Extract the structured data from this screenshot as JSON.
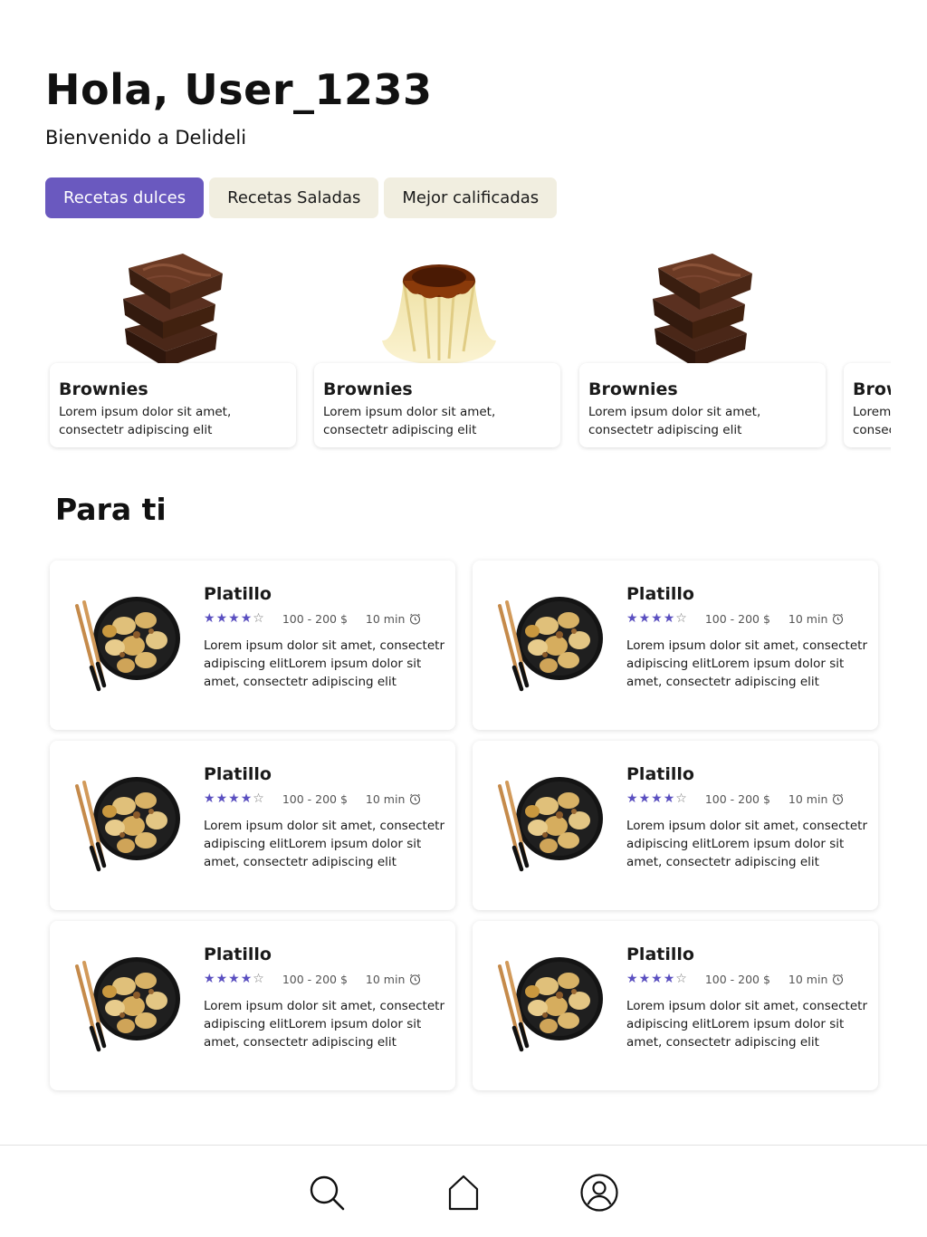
{
  "header": {
    "greeting": "Hola, User_1233",
    "subtitle": "Bienvenido a Delideli"
  },
  "tabs": [
    {
      "label": "Recetas dulces",
      "active": true
    },
    {
      "label": "Recetas Saladas",
      "active": false
    },
    {
      "label": "Mejor calificadas",
      "active": false
    }
  ],
  "sweets": [
    {
      "name": "Brownies",
      "description": "Lorem ipsum dolor sit amet, consectetr adipiscing elit",
      "image": "brownie"
    },
    {
      "name": "Brownies",
      "description": "Lorem ipsum dolor sit amet, consectetr adipiscing elit",
      "image": "flan"
    },
    {
      "name": "Brownies",
      "description": "Lorem ipsum dolor sit amet, consectetr adipiscing elit",
      "image": "brownie"
    },
    {
      "name": "Brownies",
      "description": "Lorem ipsum dolor sit amet, consectetr adipiscing elit",
      "image": "brownie"
    }
  ],
  "for_you": {
    "title": "Para ti",
    "dishes": [
      {
        "name": "Platillo",
        "rating": 4,
        "max_rating": 5,
        "price": "100 - 200 $",
        "time": "10 min",
        "description": "Lorem ipsum dolor sit amet, consectetr adipiscing elitLorem ipsum dolor sit amet, consectetr adipiscing elit"
      },
      {
        "name": "Platillo",
        "rating": 4,
        "max_rating": 5,
        "price": "100 - 200 $",
        "time": "10 min",
        "description": "Lorem ipsum dolor sit amet, consectetr adipiscing elitLorem ipsum dolor sit amet, consectetr adipiscing elit"
      },
      {
        "name": "Platillo",
        "rating": 4,
        "max_rating": 5,
        "price": "100 - 200 $",
        "time": "10 min",
        "description": "Lorem ipsum dolor sit amet, consectetr adipiscing elitLorem ipsum dolor sit amet, consectetr adipiscing elit"
      },
      {
        "name": "Platillo",
        "rating": 4,
        "max_rating": 5,
        "price": "100 - 200 $",
        "time": "10 min",
        "description": "Lorem ipsum dolor sit amet, consectetr adipiscing elitLorem ipsum dolor sit amet, consectetr adipiscing elit"
      },
      {
        "name": "Platillo",
        "rating": 4,
        "max_rating": 5,
        "price": "100 - 200 $",
        "time": "10 min",
        "description": "Lorem ipsum dolor sit amet, consectetr adipiscing elitLorem ipsum dolor sit amet, consectetr adipiscing elit"
      },
      {
        "name": "Platillo",
        "rating": 4,
        "max_rating": 5,
        "price": "100 - 200 $",
        "time": "10 min",
        "description": "Lorem ipsum dolor sit amet, consectetr adipiscing elitLorem ipsum dolor sit amet, consectetr adipiscing elit"
      }
    ]
  },
  "bottom_nav": {
    "items": [
      {
        "icon": "search-icon"
      },
      {
        "icon": "home-icon"
      },
      {
        "icon": "user-icon"
      }
    ]
  },
  "colors": {
    "accent": "#6a59bf",
    "tab_inactive": "#f1eee0",
    "star": "#5a4fc0"
  }
}
